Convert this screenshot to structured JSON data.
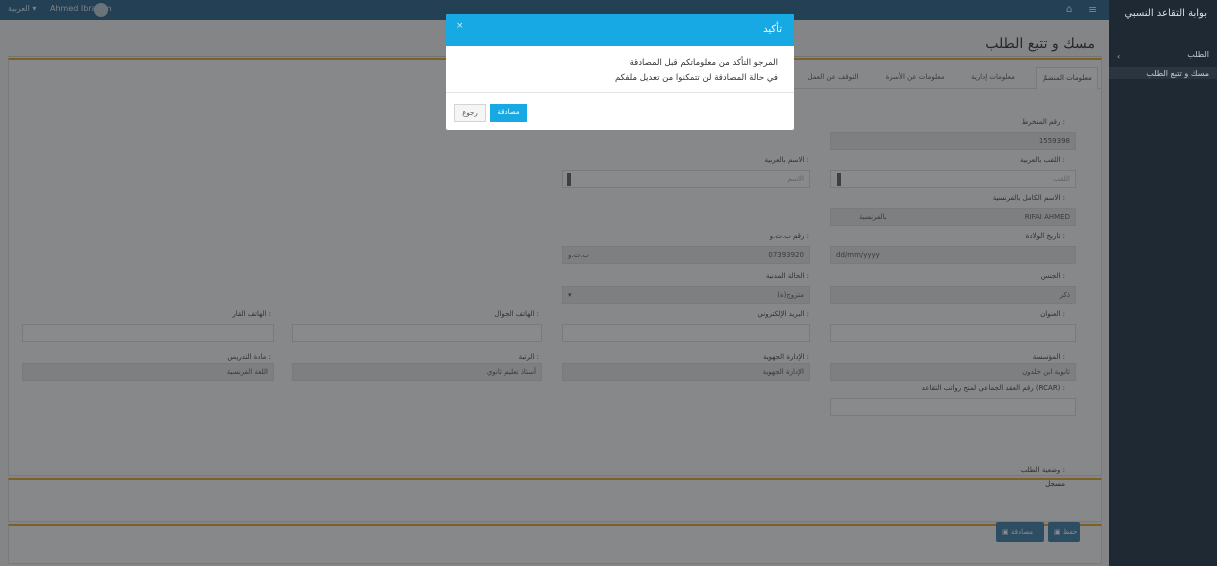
{
  "topbar": {
    "lang": "العربية ▾",
    "user": "Ahmed Ibrahim"
  },
  "sidebar": {
    "brand": "بوابة التقاعد النسبي",
    "items": [
      {
        "label": "الطلب"
      },
      {
        "label": "مسك و تتبع الطلب"
      }
    ]
  },
  "page": {
    "title": "مسك و تتبع الطلب"
  },
  "tabs": [
    {
      "label": "معلومات المنضمّ",
      "active": true
    },
    {
      "label": "معلومات إدارية",
      "active": false
    },
    {
      "label": "معلومات عن الأسرة",
      "active": false
    },
    {
      "label": "التوقف عن العمل",
      "active": false
    }
  ],
  "form": {
    "matricule_label": "رقم المنخرط :",
    "matricule_value": "1559398",
    "lastname_ar_label": "اللقب بالعربية :",
    "lastname_ar_placeholder": "اللقب",
    "firstname_ar_label": "الاسم بالعربية :",
    "firstname_ar_placeholder": "الاسم",
    "fullname_fr_label": "الاسم الكامل بالفرنسية :",
    "fullname_fr_value": "RIFAI AHMED",
    "fullname_fr_prefix": "بالفرنسية",
    "birthdate_label": "تاريخ الولادة :",
    "birthdate_placeholder": "dd/mm/yyyy",
    "cin_label": "رقم ب.ت.و :",
    "cin_value": "07393920",
    "cin_prefix": "ب.ت.و",
    "gender_label": "الجنس :",
    "gender_value": "ذكر",
    "civil_status_label": "الحالة المدنية :",
    "civil_status_value": "متزوج(ة)",
    "address_label": "العنوان :",
    "email_label": "البريد الإلكتروني :",
    "mobile_label": "الهاتف الجوال :",
    "phone_label": "الهاتف القار :",
    "institution_label": "المؤسسة :",
    "institution_value": "ثانوية ابن خلدون",
    "region_label": "الإدارة الجهوية :",
    "region_value": "الإدارة الجهوية",
    "grade_label": "الرتبة :",
    "grade_value": "أستاذ تعليم ثانوي",
    "subject_label": "مادة التدريس :",
    "subject_value": "اللغة الفرنسية",
    "rcar_label": "رقم العقد الجماعي لمنح رواتب التقاعد (RCAR) :"
  },
  "status": {
    "label": "وضعية الطلب :",
    "value": "مسجل"
  },
  "actions": {
    "save": "حفظ",
    "submit": "مصادقة"
  },
  "modal": {
    "title": "تأكيد",
    "line1": "المرجو التأكد من معلوماتكم قبل المصادقة",
    "line2": "في حالة المصادقة لن تتمكنوا من تعديل ملفكم",
    "confirm": "مصادقة",
    "back": "رجوع"
  }
}
